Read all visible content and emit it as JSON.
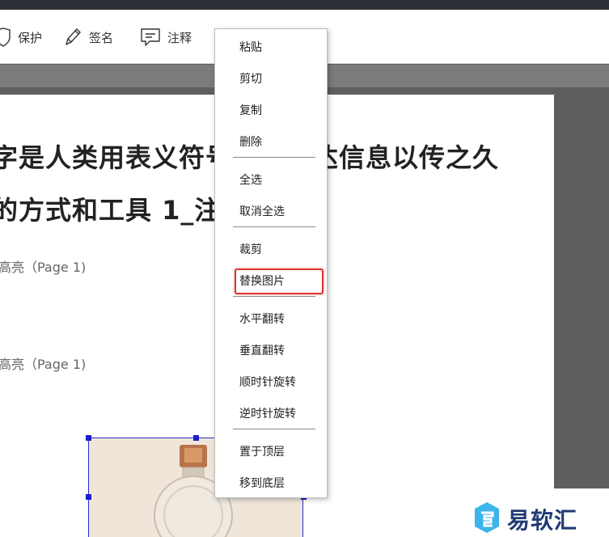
{
  "toolbar": {
    "protect_label": "保护",
    "sign_label": "签名",
    "annotate_label": "注释"
  },
  "document": {
    "heading_line1": "字是人类用表义符号记录表达信息以传之久",
    "heading_line2": "的方式和工具 1_注释",
    "highlight1": "高亮（Page 1)",
    "highlight2": "高亮（Page 1)"
  },
  "context_menu": {
    "items": [
      "粘贴",
      "剪切",
      "复制",
      "删除",
      "全选",
      "取消全选",
      "裁剪",
      "替换图片",
      "水平翻转",
      "垂直翻转",
      "顺时针旋转",
      "逆时针旋转",
      "置于顶层",
      "移到底层"
    ]
  },
  "watermark": {
    "text": "易软汇"
  },
  "colors": {
    "highlight_border": "#d9362c",
    "selection_handles": "#1d1dcc",
    "logo_blue": "#1f3b73",
    "logo_cyan": "#3db4ea"
  }
}
